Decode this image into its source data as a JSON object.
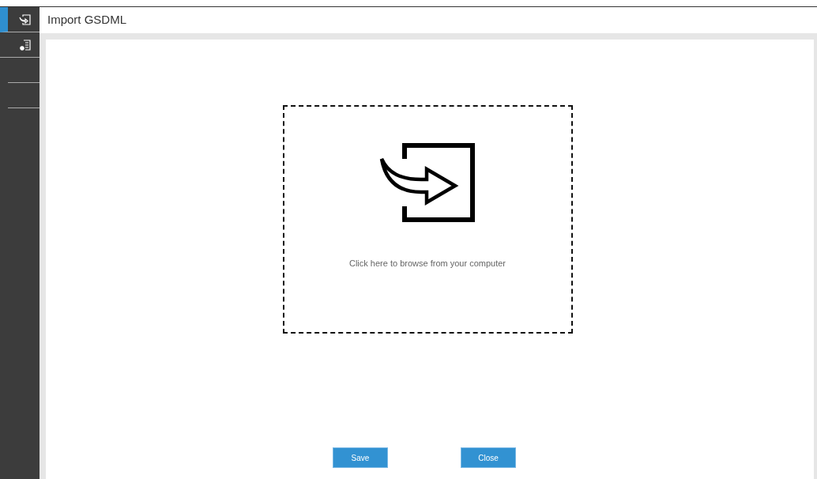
{
  "sidebar": {
    "items": [
      {
        "kind": "import",
        "selected": true
      },
      {
        "kind": "device",
        "selected": false
      }
    ]
  },
  "header": {
    "title": "Import GSDML"
  },
  "dropzone": {
    "hint": "Click here to browse from your computer"
  },
  "buttons": [
    {
      "label": "Save"
    },
    {
      "label": "Close"
    }
  ]
}
